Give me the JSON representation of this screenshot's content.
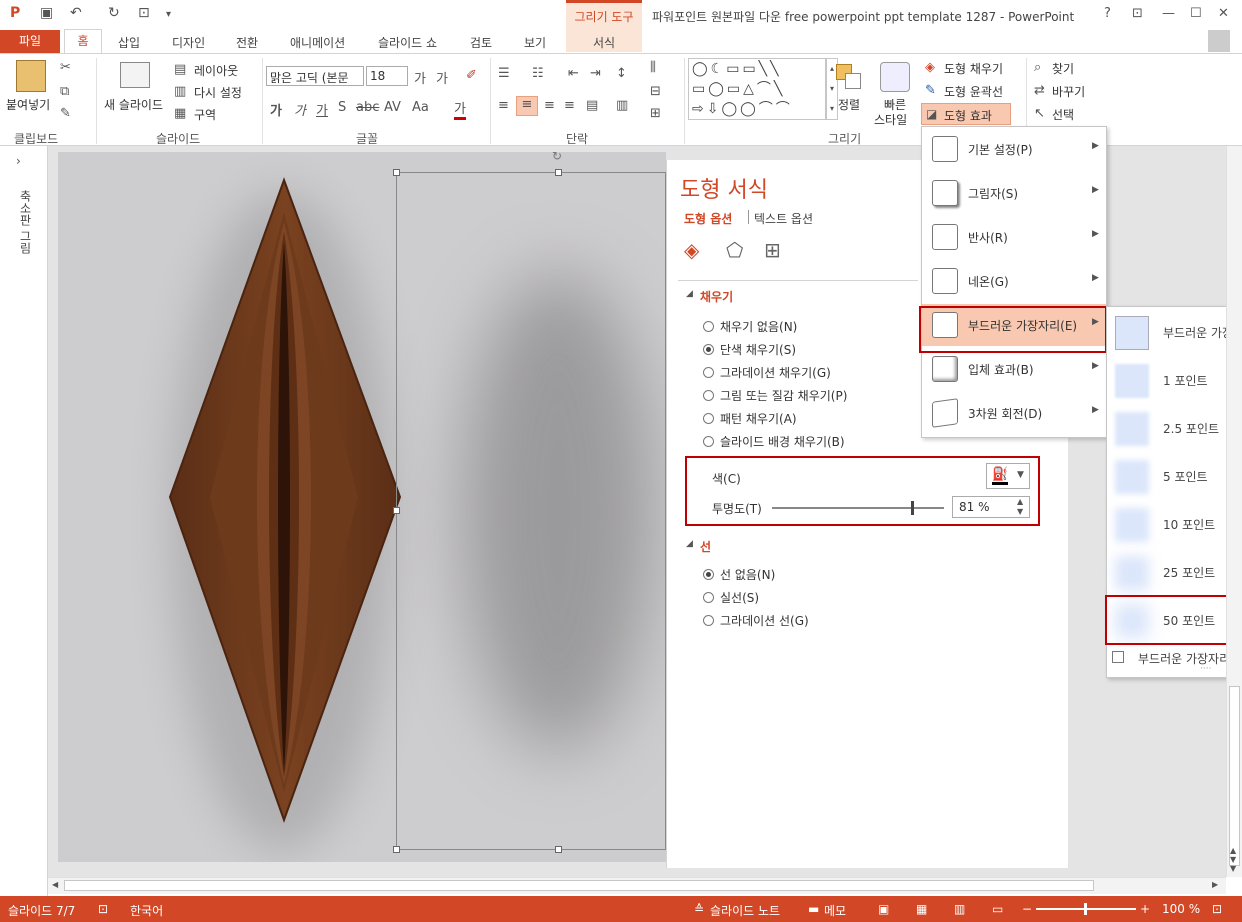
{
  "titlebar": {
    "document_title": "파워포인트 원본파일 다운 free powerpoint ppt template 1287 - PowerPoint",
    "context_tab_group": "그리기 도구",
    "context_tab": "서식",
    "help": "?"
  },
  "tabs": {
    "file": "파일",
    "home": "홈",
    "insert": "삽입",
    "design": "디자인",
    "transitions": "전환",
    "animations": "애니메이션",
    "slideshow": "슬라이드 쇼",
    "review": "검토",
    "view": "보기"
  },
  "ribbon": {
    "clipboard": {
      "paste": "붙여넣기",
      "label": "클립보드"
    },
    "slides": {
      "new_slide": "새 슬라이드",
      "layout": "레이아웃",
      "reset": "다시 설정",
      "section": "구역",
      "label": "슬라이드"
    },
    "font": {
      "name": "맑은 고딕 (본문",
      "size": "18",
      "label": "글꼴"
    },
    "paragraph": {
      "label": "단락"
    },
    "drawing": {
      "arrange": "정렬",
      "quick_styles_1": "빠른",
      "quick_styles_2": "스타일",
      "shape_fill": "도형 채우기",
      "shape_outline": "도형 윤곽선",
      "shape_effects": "도형 효과",
      "label": "그리기"
    },
    "editing": {
      "find": "찾기",
      "replace": "바꾸기",
      "select": "선택"
    }
  },
  "left_pane": {
    "label": "축소판 그림"
  },
  "format_pane": {
    "title": "도형 서식",
    "tab_shape": "도형 옵션",
    "tab_text": "텍스트 옵션",
    "fill_section": "채우기",
    "fill_options": [
      {
        "label": "채우기 없음(N)",
        "selected": false
      },
      {
        "label": "단색 채우기(S)",
        "selected": true
      },
      {
        "label": "그라데이션 채우기(G)",
        "selected": false
      },
      {
        "label": "그림 또는 질감 채우기(P)",
        "selected": false
      },
      {
        "label": "패턴 채우기(A)",
        "selected": false
      },
      {
        "label": "슬라이드 배경 채우기(B)",
        "selected": false
      }
    ],
    "color_label": "색(C)",
    "transparency_label": "투명도(T)",
    "transparency_value": "81 %",
    "transparency_fraction": 0.81,
    "line_section": "선",
    "line_options": [
      {
        "label": "선 없음(N)",
        "selected": true
      },
      {
        "label": "실선(S)",
        "selected": false
      },
      {
        "label": "그라데이션 선(G)",
        "selected": false
      }
    ]
  },
  "effects_menu": {
    "items": [
      {
        "label": "기본 설정(P)"
      },
      {
        "label": "그림자(S)"
      },
      {
        "label": "반사(R)"
      },
      {
        "label": "네온(G)"
      },
      {
        "label": "부드러운 가장자리(E)"
      },
      {
        "label": "입체 효과(B)"
      },
      {
        "label": "3차원 회전(D)"
      }
    ]
  },
  "soft_edges_menu": {
    "items": [
      {
        "label": "부드러운 가장자"
      },
      {
        "label": "1 포인트"
      },
      {
        "label": "2.5 포인트"
      },
      {
        "label": "5 포인트"
      },
      {
        "label": "10 포인트"
      },
      {
        "label": "25 포인트"
      },
      {
        "label": "50 포인트"
      }
    ],
    "options_label": "부드러운 가장자리"
  },
  "statusbar": {
    "slide": "슬라이드 7/7",
    "language": "한국어",
    "notes": "슬라이드 노트",
    "comments": "메모",
    "zoom": "100 %"
  },
  "colors": {
    "accent": "#d24726",
    "highlight": "#c00000",
    "leaf": "#6b3a1e"
  }
}
